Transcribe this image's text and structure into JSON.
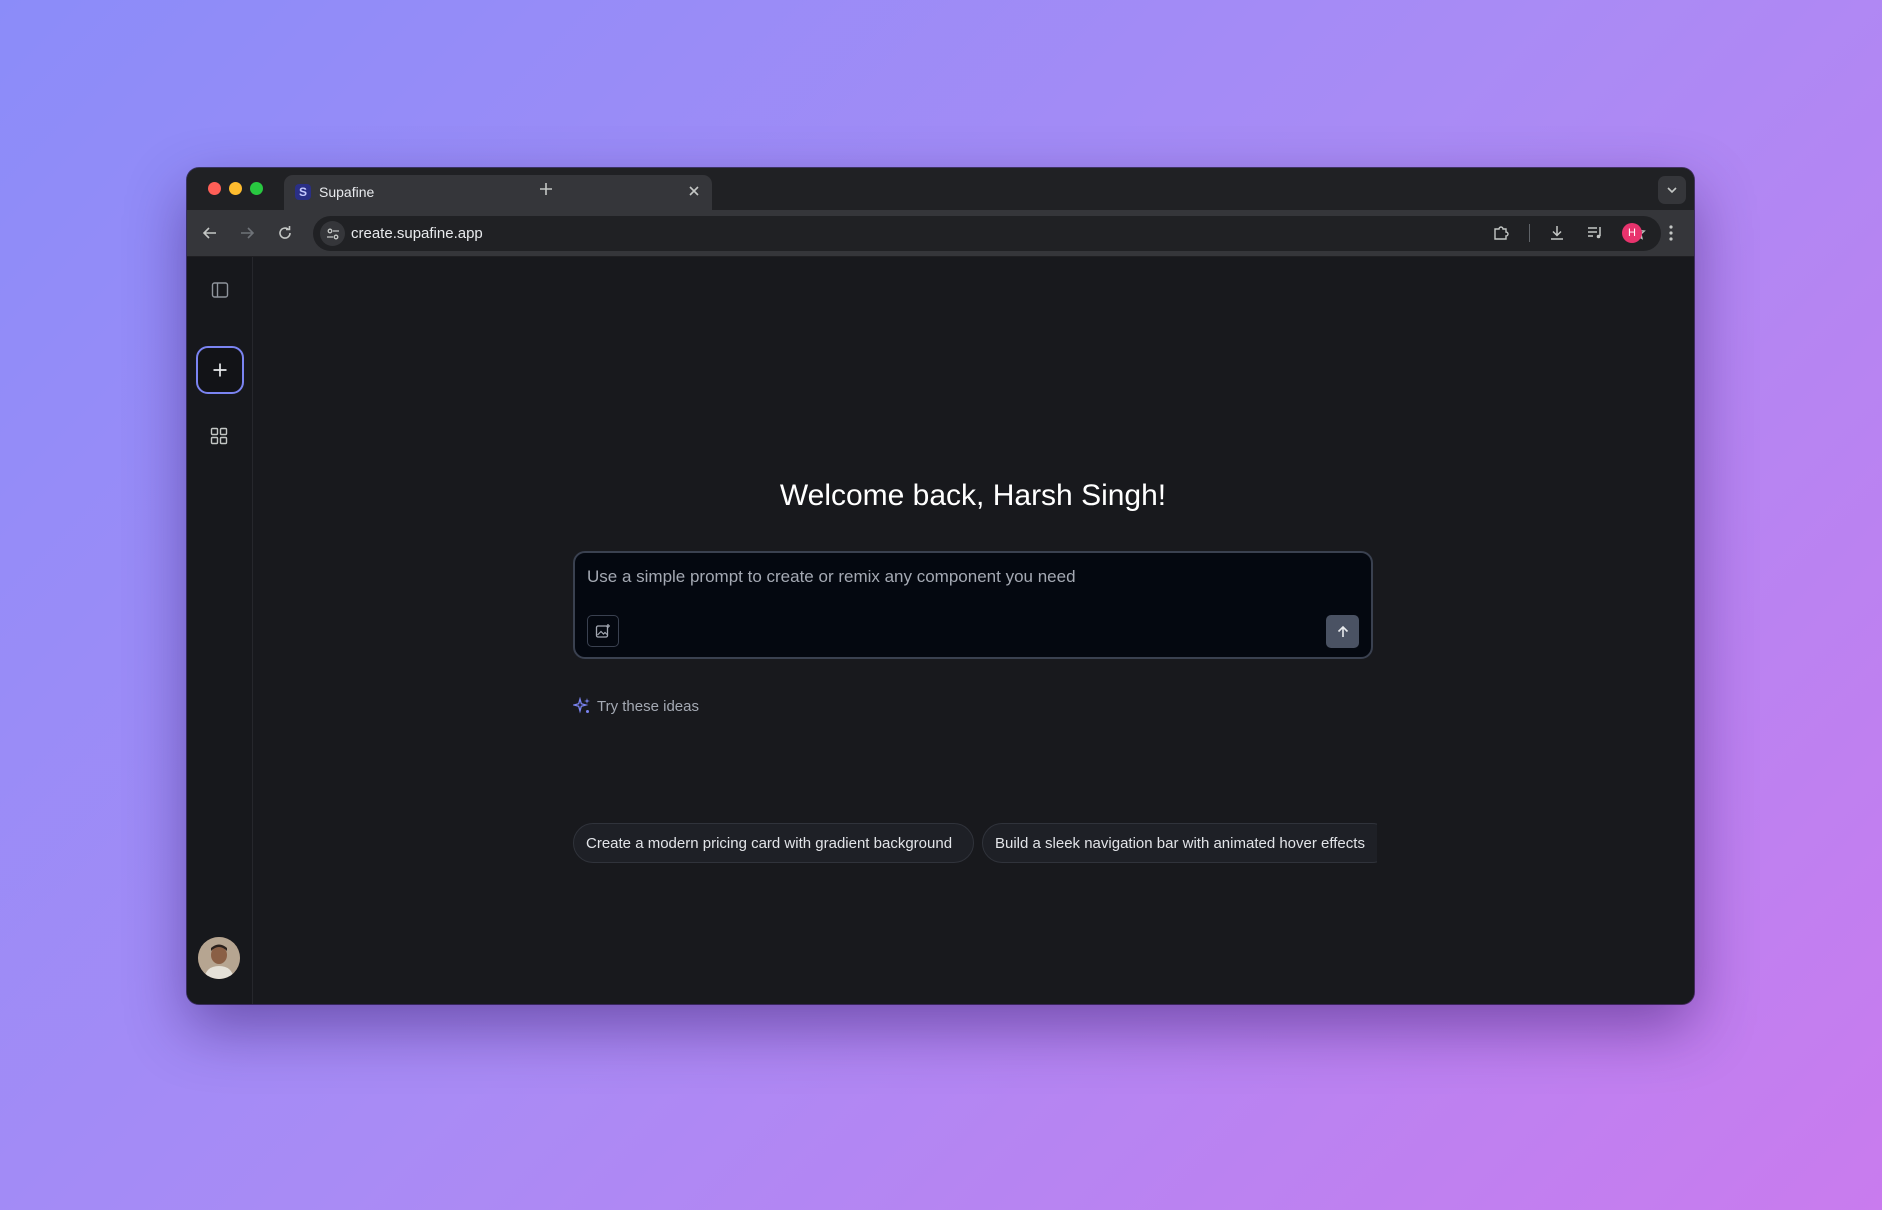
{
  "browser": {
    "tab": {
      "title": "Supafine",
      "favicon_letter": "S"
    },
    "url": "create.supafine.app",
    "profile_initial": "H"
  },
  "app": {
    "welcome_title": "Welcome back, Harsh Singh!",
    "prompt": {
      "placeholder": "Use a simple prompt to create or remix any component you need"
    },
    "ideas": {
      "label": "Try these ideas",
      "items": [
        "Create a modern pricing card with gradient background",
        "Build a sleek navigation bar with animated hover effects"
      ]
    }
  },
  "colors": {
    "accent": "#7b84f2",
    "background": "#18191d",
    "profile": "#e8336d"
  }
}
